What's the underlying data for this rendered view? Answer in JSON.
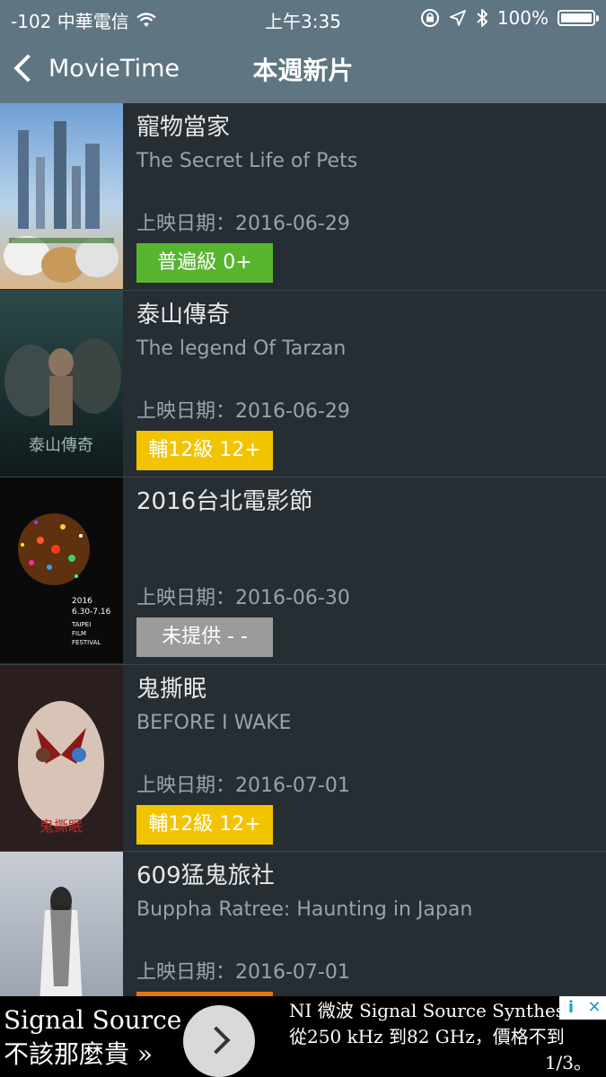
{
  "status_bar": {
    "carrier": "-102 中華電信",
    "time": "上午3:35",
    "battery": "100%",
    "icons": [
      "wifi-icon",
      "rotation-lock-icon",
      "location-icon",
      "bluetooth-icon",
      "battery-icon"
    ]
  },
  "nav": {
    "back_label": "MovieTime",
    "title": "本週新片"
  },
  "movies": [
    {
      "title_zh": "寵物當家",
      "title_en": "The Secret Life of Pets",
      "release": "上映日期：2016-06-29",
      "rating": "普遍級  0+",
      "rating_color": "#57b52f"
    },
    {
      "title_zh": "泰山傳奇",
      "title_en": "The legend Of Tarzan",
      "release": "上映日期：2016-06-29",
      "rating": "輔12級 12+",
      "rating_color": "#f2c400"
    },
    {
      "title_zh": "2016台北電影節",
      "title_en": "",
      "release": "上映日期：2016-06-30",
      "rating": "未提供 - -",
      "rating_color": "#9b9b9b"
    },
    {
      "title_zh": "鬼撕眠",
      "title_en": "BEFORE I WAKE",
      "release": "上映日期：2016-07-01",
      "rating": "輔12級 12+",
      "rating_color": "#f2c400"
    },
    {
      "title_zh": "609猛鬼旅社",
      "title_en": "Buppha Ratree: Haunting in Japan",
      "release": "上映日期：2016-07-01",
      "rating": "",
      "rating_color": "#e8740c"
    }
  ],
  "ad": {
    "left_line1": "Signal Source",
    "left_line2": "不該那麼貴 »",
    "right_line1": "NI 微波 Signal Source Synthes",
    "right_line2": "從250 kHz 到82 GHz，價格不到",
    "right_line3": "1/3。",
    "info_icon": "i",
    "close_icon": "✕"
  }
}
